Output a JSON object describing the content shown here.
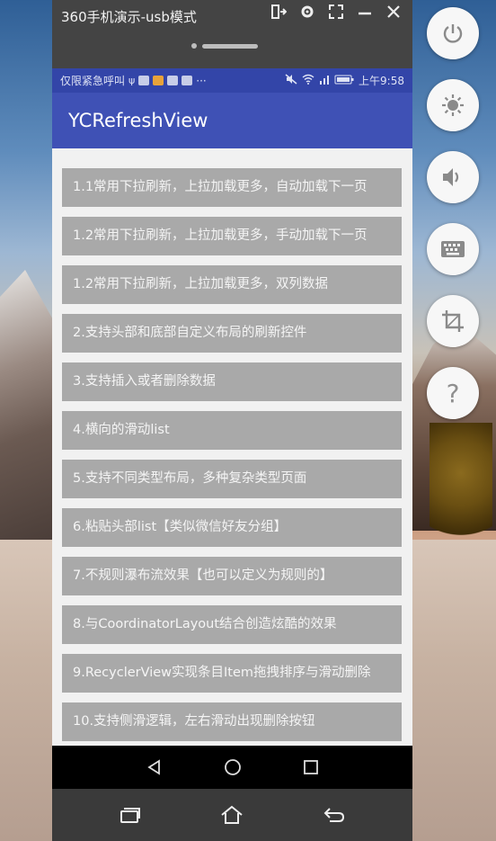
{
  "window": {
    "title": "360手机演示-usb模式",
    "icons": [
      "pin-icon",
      "gear-icon",
      "fullscreen-icon",
      "minimize-icon",
      "close-icon"
    ]
  },
  "status_bar": {
    "left_text": "仅限紧急呼叫",
    "time": "上午9:58"
  },
  "app_bar": {
    "title": "YCRefreshView"
  },
  "menu": {
    "items": [
      "1.1常用下拉刷新，上拉加载更多，自动加载下一页",
      "1.2常用下拉刷新，上拉加载更多，手动加载下一页",
      "1.2常用下拉刷新，上拉加载更多，双列数据",
      "2.支持头部和底部自定义布局的刷新控件",
      "3.支持插入或者删除数据",
      "4.横向的滑动list",
      "5.支持不同类型布局，多种复杂类型页面",
      "6.粘贴头部list【类似微信好友分组】",
      "7.不规则瀑布流效果【也可以定义为规则的】",
      "8.与CoordinatorLayout结合创造炫酷的效果",
      "9.RecyclerView实现条目Item拖拽排序与滑动删除",
      "10.支持侧滑逻辑，左右滑动出现删除按钮"
    ]
  },
  "side_buttons": [
    "power-icon",
    "brightness-icon",
    "volume-icon",
    "keyboard-icon",
    "crop-icon",
    "help-icon"
  ],
  "help_glyph": "?",
  "colors": {
    "app_bar": "#3f51b5",
    "status_bar": "#3345a8",
    "item_bg": "#a9a9a9"
  }
}
